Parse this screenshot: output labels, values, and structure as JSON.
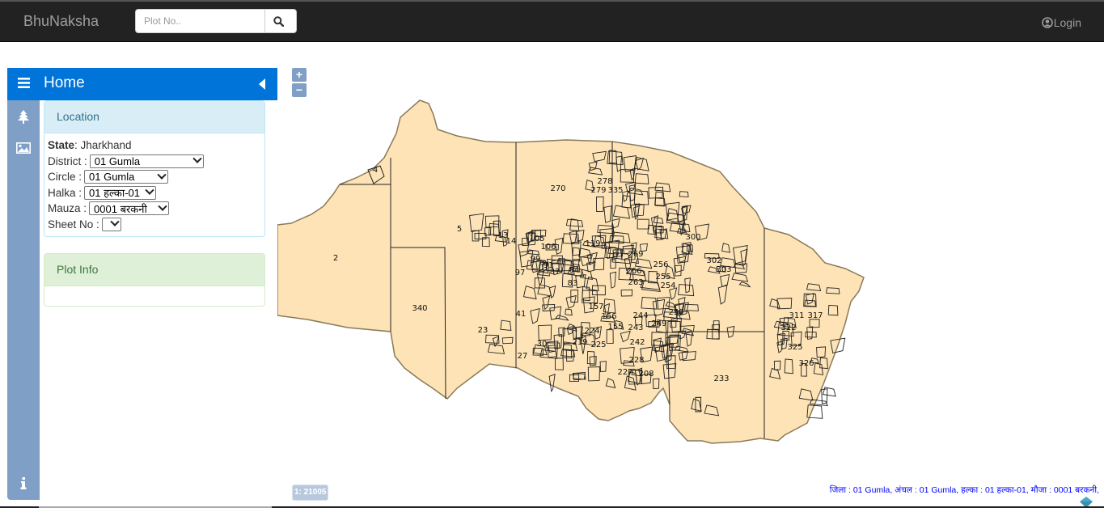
{
  "app": {
    "brand": "BhuNaksha",
    "search_placeholder": "Plot No..",
    "login_label": "Login"
  },
  "sidebar": {
    "title": "Home",
    "tabs": [
      {
        "icon": "tree-icon"
      },
      {
        "icon": "image-icon"
      },
      {
        "icon": "info-icon"
      }
    ],
    "location_panel": {
      "heading": "Location",
      "state_label": "State",
      "state_value": ": Jharkhand",
      "fields": [
        {
          "label": "District :",
          "value": "01 Gumla"
        },
        {
          "label": "Circle :",
          "value": "01 Gumla"
        },
        {
          "label": "Halka :",
          "value": "01 हल्का-01"
        },
        {
          "label": "Mauza :",
          "value": "0001 बरकनी"
        },
        {
          "label": "Sheet No :",
          "value": ""
        }
      ]
    },
    "plot_panel": {
      "heading": "Plot Info"
    }
  },
  "map": {
    "zoom_in": "+",
    "zoom_out": "−",
    "scale": "1: 21005",
    "footer_info": "जिला : 01 Gumla, अंचल : 01 Gumla, हल्का : 01 हल्का-01, मौजा : 0001 बरकनी,",
    "fill_color": "#fde3b5",
    "plot_labels": [
      {
        "id": "2"
      },
      {
        "id": "4"
      },
      {
        "id": "5"
      },
      {
        "id": "13"
      },
      {
        "id": "14"
      },
      {
        "id": "23"
      },
      {
        "id": "27"
      },
      {
        "id": "30"
      },
      {
        "id": "41"
      },
      {
        "id": "83"
      },
      {
        "id": "84"
      },
      {
        "id": "87"
      },
      {
        "id": "91"
      },
      {
        "id": "97"
      },
      {
        "id": "99"
      },
      {
        "id": "105"
      },
      {
        "id": "106"
      },
      {
        "id": "119"
      },
      {
        "id": "155"
      },
      {
        "id": "156"
      },
      {
        "id": "157"
      },
      {
        "id": "208"
      },
      {
        "id": "219"
      },
      {
        "id": "224"
      },
      {
        "id": "225"
      },
      {
        "id": "227"
      },
      {
        "id": "228"
      },
      {
        "id": "233"
      },
      {
        "id": "242"
      },
      {
        "id": "243"
      },
      {
        "id": "244"
      },
      {
        "id": "249"
      },
      {
        "id": "250"
      },
      {
        "id": "254"
      },
      {
        "id": "255"
      },
      {
        "id": "256"
      },
      {
        "id": "263"
      },
      {
        "id": "266"
      },
      {
        "id": "269"
      },
      {
        "id": "270"
      },
      {
        "id": "278"
      },
      {
        "id": "279"
      },
      {
        "id": "300"
      },
      {
        "id": "302"
      },
      {
        "id": "303"
      },
      {
        "id": "311"
      },
      {
        "id": "317"
      },
      {
        "id": "322"
      },
      {
        "id": "325"
      },
      {
        "id": "326"
      },
      {
        "id": "335"
      },
      {
        "id": "340"
      }
    ]
  }
}
